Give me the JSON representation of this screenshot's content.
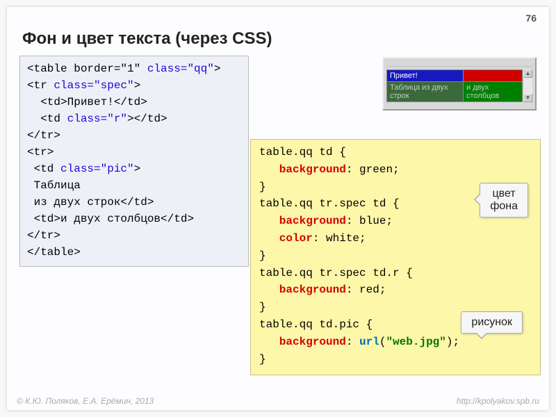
{
  "page_number": "76",
  "title": "Фон и цвет текста (через CSS)",
  "html_snippet": {
    "l1a": "<table border=\"1\" ",
    "l1b": "class=\"qq\"",
    "l1c": ">",
    "l2a": "<tr ",
    "l2b": "class=\"spec\"",
    "l2c": ">",
    "l3": "  <td>Привет!</td>",
    "l4a": "  <td ",
    "l4b": "class=\"r\"",
    "l4c": "></td>",
    "l5": "</tr>",
    "l6": "<tr>",
    "l7a": " <td ",
    "l7b": "class=\"pic\"",
    "l7c": ">",
    "l8": " Таблица",
    "l9": " из двух строк</td>",
    "l10": " <td>и двух столбцов</td>",
    "l11": "</tr>",
    "l12": "</table>"
  },
  "css_snippet": {
    "r1": "table.qq td {",
    "r2a": "   background",
    "r2b": ": green;",
    "r3": "}",
    "r4": "table.qq tr.spec td {",
    "r5a": "   background",
    "r5b": ": blue;",
    "r6a": "   color",
    "r6b": ": white;",
    "r7": "}",
    "r8": "table.qq tr.spec td.r {",
    "r9a": "   background",
    "r9b": ": red;",
    "r10": "}",
    "r11": "table.qq td.pic {",
    "r12a": "   background",
    "r12b": ": ",
    "r12c": "url",
    "r12d": "(",
    "r12e": "\"web.jpg\"",
    "r12f": ");",
    "r13": "}"
  },
  "preview": {
    "cell_hello": "Привет!",
    "cell_two_rows": "Таблица из двух строк",
    "cell_two_cols": "и двух столбцов"
  },
  "callouts": {
    "bg_color": "цвет\nфона",
    "picture": "рисунок"
  },
  "footer": {
    "left": "© К.Ю. Поляков, Е.А. Ерёмин, 2013",
    "right": "http://kpolyakov.spb.ru"
  }
}
